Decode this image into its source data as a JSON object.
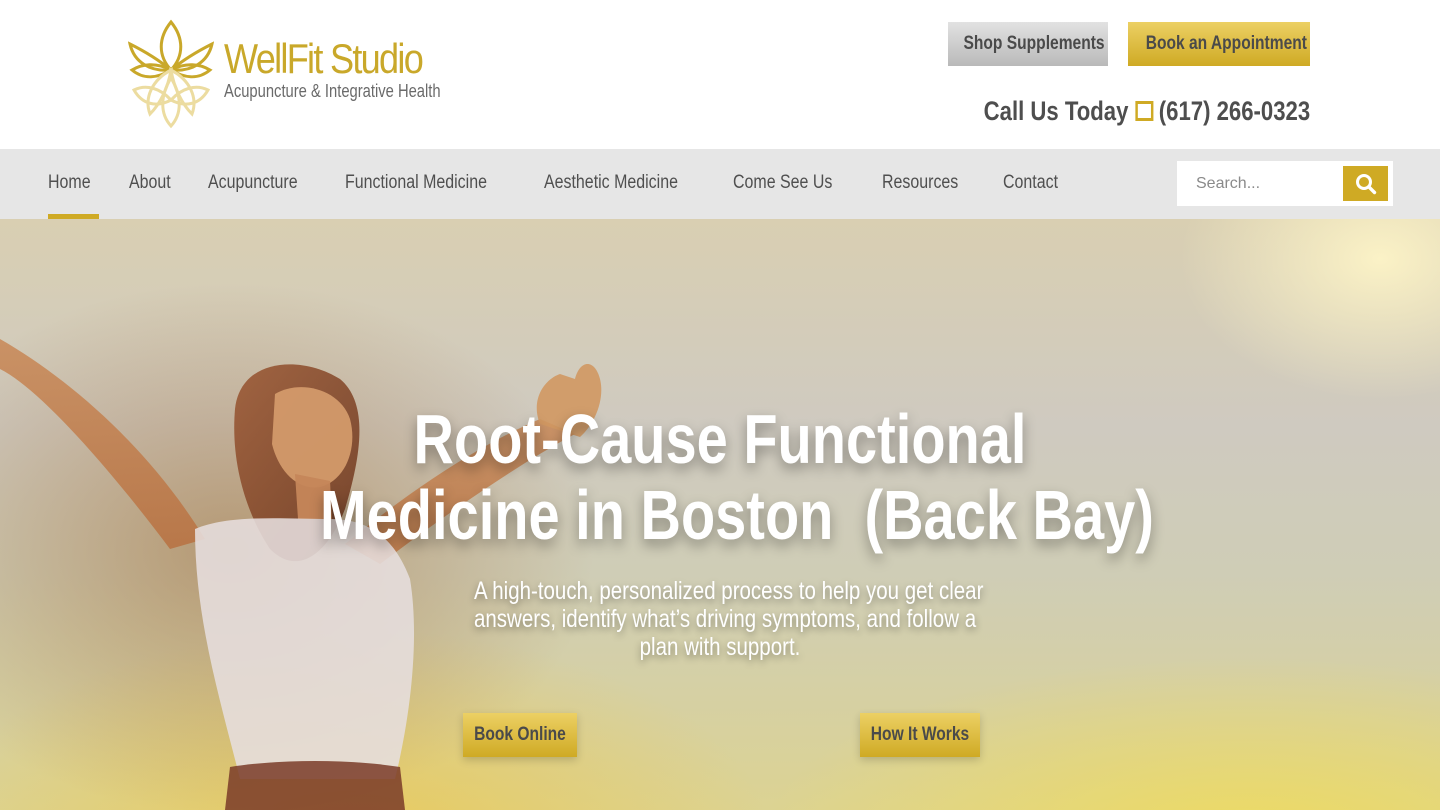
{
  "brand": {
    "name": "WellFit Studio",
    "tagline": "Acupuncture & Integrative Health",
    "logo_icon": "lotus-logo-icon",
    "accent_color": "#cfaa24"
  },
  "header": {
    "shop_label": "Shop Supplements",
    "book_label": "Book an Appointment",
    "call_prefix": "Call Us Today",
    "call_icon": "phone-icon",
    "phone": "(617) 266-0323"
  },
  "nav": {
    "items": [
      {
        "label": "Home",
        "active": true
      },
      {
        "label": "About"
      },
      {
        "label": "Acupuncture"
      },
      {
        "label": "Functional Medicine"
      },
      {
        "label": "Aesthetic Medicine"
      },
      {
        "label": "Come See Us"
      },
      {
        "label": "Resources"
      },
      {
        "label": "Contact"
      }
    ],
    "search_placeholder": "Search...",
    "search_icon": "search-icon"
  },
  "hero": {
    "title_line1": "Root-Cause Functional",
    "title_line2": "Medicine in Boston  (Back Bay)",
    "subtitle_line1": "A high-touch, personalized process to help you get clear",
    "subtitle_line2": "answers, identify what’s driving symptoms, and follow a",
    "subtitle_line3": "plan with support.",
    "primary_cta": "Book Online",
    "secondary_cta": "How It Works"
  }
}
